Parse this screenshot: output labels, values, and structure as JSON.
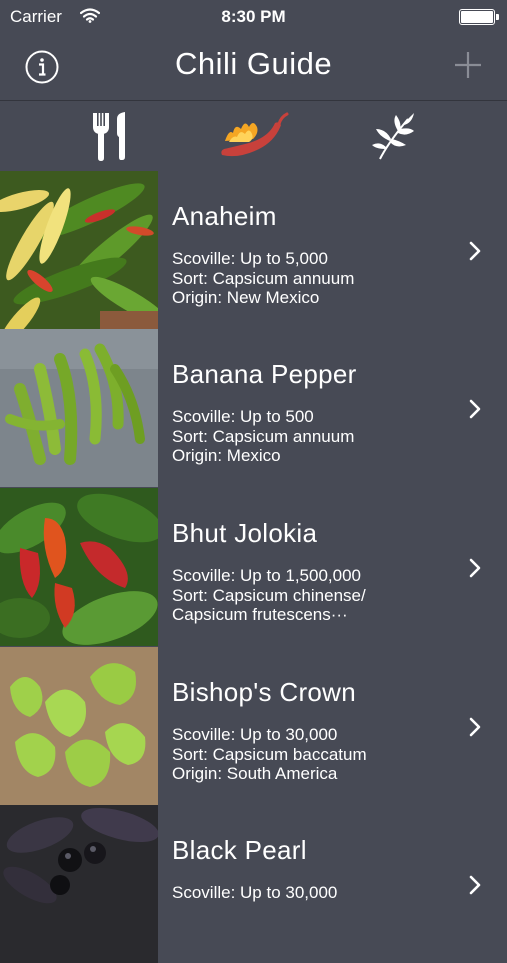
{
  "status_bar": {
    "carrier": "Carrier",
    "time": "8:30 PM"
  },
  "nav": {
    "title": "Chili Guide",
    "info_icon": "info-circle-icon",
    "add_icon": "plus-icon"
  },
  "segments": [
    {
      "icon": "fork-knife-icon",
      "selected": false
    },
    {
      "icon": "chili-pepper-icon",
      "selected": true
    },
    {
      "icon": "herb-leaf-icon",
      "selected": false
    }
  ],
  "peppers": [
    {
      "name": "Anaheim",
      "line1": "Scoville: Up to 5,000",
      "line2": "Sort: Capsicum annuum",
      "line3": "Origin: New Mexico"
    },
    {
      "name": "Banana Pepper",
      "line1": "Scoville: Up to 500",
      "line2": "Sort: Capsicum annuum",
      "line3": "Origin: Mexico"
    },
    {
      "name": "Bhut Jolokia",
      "line1": "Scoville: Up to 1,500,000",
      "line2": "Sort: Capsicum chinense/",
      "line3": "Capsicum frutescens···"
    },
    {
      "name": "Bishop's Crown",
      "line1": "Scoville: Up to 30,000",
      "line2": "Sort: Capsicum baccatum",
      "line3": "Origin: South America"
    },
    {
      "name": "Black Pearl",
      "line1": "Scoville: Up to 30,000",
      "line2": "",
      "line3": ""
    }
  ]
}
